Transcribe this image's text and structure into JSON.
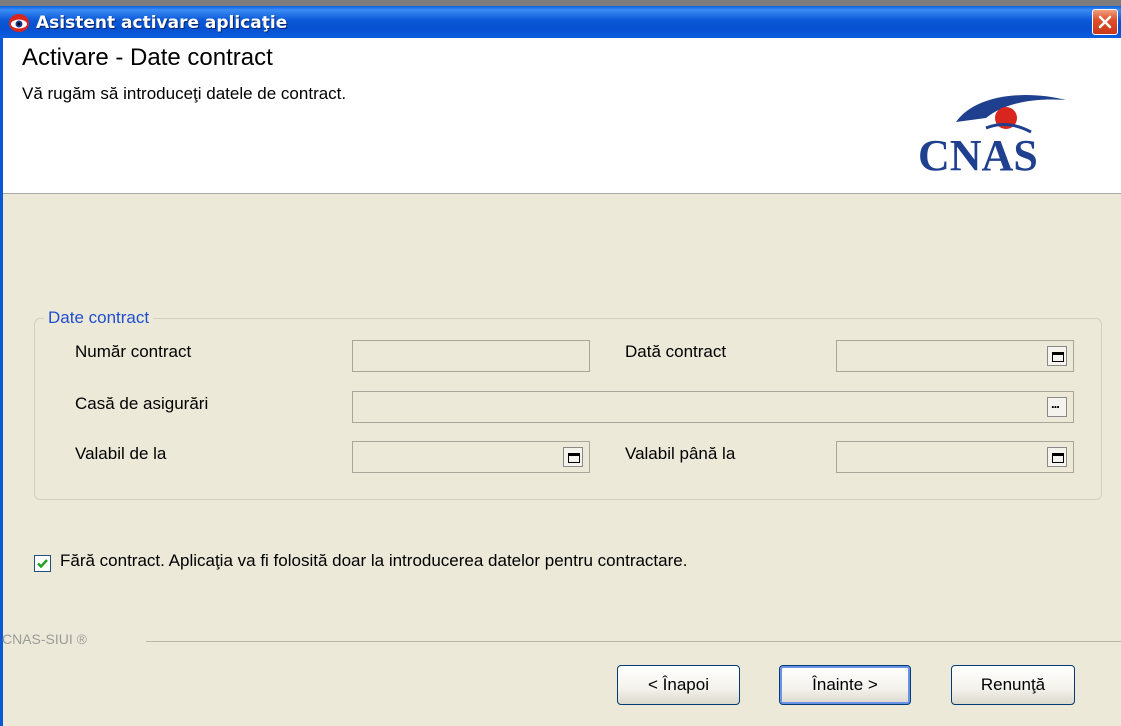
{
  "window": {
    "title": "Asistent activare aplicaţie"
  },
  "header": {
    "title": "Activare - Date contract",
    "subtitle": "Vă rugăm să introduceţi datele de contract.",
    "logo_text": "CNAS"
  },
  "group": {
    "legend": "Date contract",
    "fields": {
      "numar_contract": {
        "label": "Număr contract",
        "value": ""
      },
      "data_contract": {
        "label": "Dată contract",
        "value": ""
      },
      "casa_asigurari": {
        "label": "Casă de asigurări",
        "value": ""
      },
      "valabil_de_la": {
        "label": "Valabil de la",
        "value": ""
      },
      "valabil_pana_la": {
        "label": "Valabil până la",
        "value": ""
      }
    }
  },
  "checkbox": {
    "label": "Fără contract. Aplicaţia va fi folosită doar la introducerea datelor pentru contractare.",
    "checked": true
  },
  "footer": {
    "brand": "CNAS-SIUI ®",
    "back_label": "< Înapoi",
    "next_label": "Înainte >",
    "cancel_label": "Renunţă"
  },
  "colors": {
    "titlebar": "#0a58d6",
    "accent": "#1f4fd0",
    "logo": "#1f3f8f",
    "checkmark": "#21a121"
  }
}
